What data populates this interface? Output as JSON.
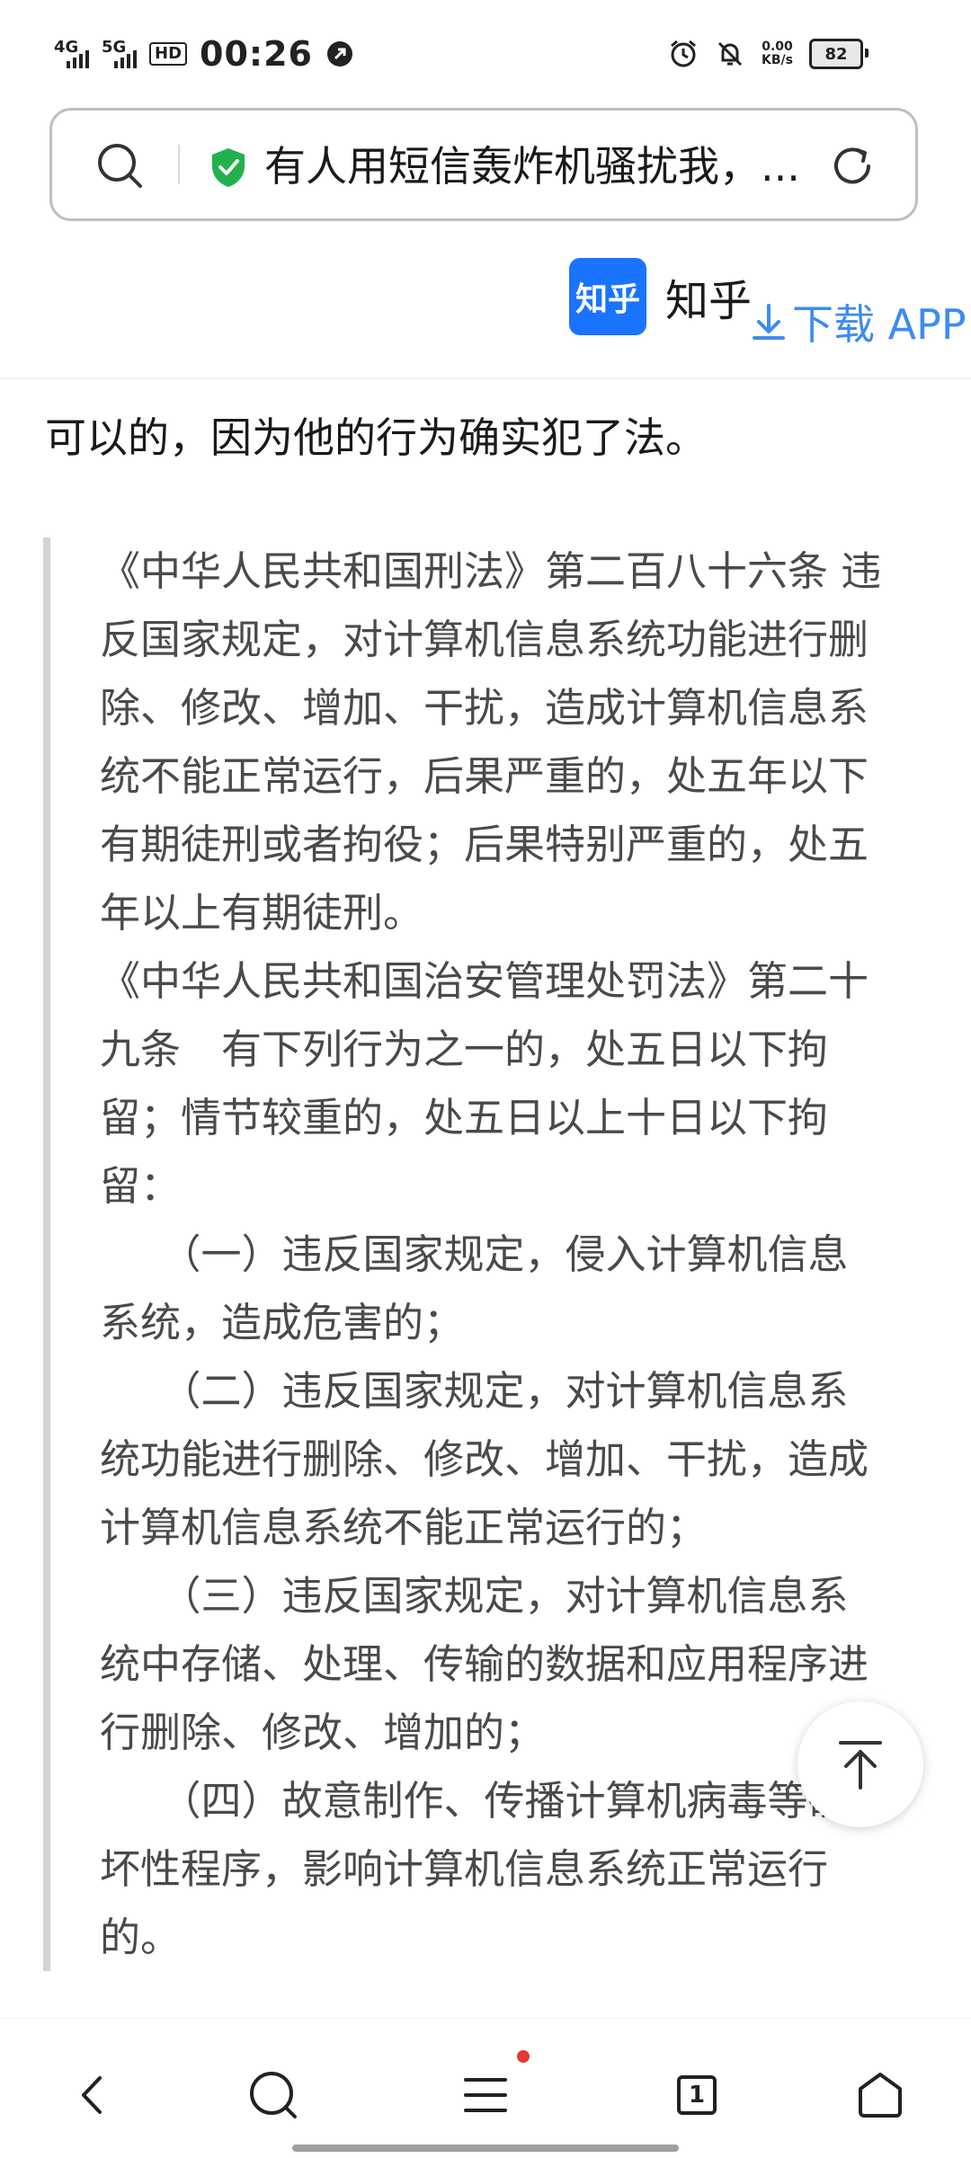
{
  "status_bar": {
    "network_1": "4G",
    "network_2": "5G",
    "hd_badge": "HD",
    "time": "00:26",
    "speed_value": "0.00",
    "speed_unit": "KB/s",
    "battery": "82"
  },
  "search_bar": {
    "url_text": "有人用短信轰炸机骚扰我，..."
  },
  "site_header": {
    "logo_text": "知乎",
    "site_name": "知乎",
    "download_label": "下载 APP"
  },
  "content": {
    "first_line": "可以的，因为他的行为确实犯了法。",
    "quote_lines": [
      "《中华人民共和国刑法》第二百八十六条 违",
      "反国家规定，对计算机信息系统功能进行删",
      "除、修改、增加、干扰，造成计算机信息系",
      "统不能正常运行，后果严重的，处五年以下",
      "有期徒刑或者拘役；后果特别严重的，处五",
      "年以上有期徒刑。",
      "《中华人民共和国治安管理处罚法》第二十",
      "九条　有下列行为之一的，处五日以下拘",
      "留；情节较重的，处五日以上十日以下拘",
      "留：",
      "　　（一）违反国家规定，侵入计算机信息",
      "系统，造成危害的；",
      "　　（二）违反国家规定，对计算机信息系",
      "统功能进行删除、修改、增加、干扰，造成",
      "计算机信息系统不能正常运行的；",
      "　　（三）违反国家规定，对计算机信息系",
      "统中存储、处理、传输的数据和应用程序进",
      "行删除、修改、增加的；",
      "　　（四）故意制作、传播计算机病毒等破",
      "坏性程序，影响计算机信息系统正常运行",
      "的。"
    ]
  },
  "bottom_nav": {
    "tabs_count": "1"
  },
  "colors": {
    "accent_blue": "#3d8bf2",
    "zhihu_blue": "#1a74ff",
    "shield_green": "#22b14c",
    "notification_red": "#e53935"
  }
}
